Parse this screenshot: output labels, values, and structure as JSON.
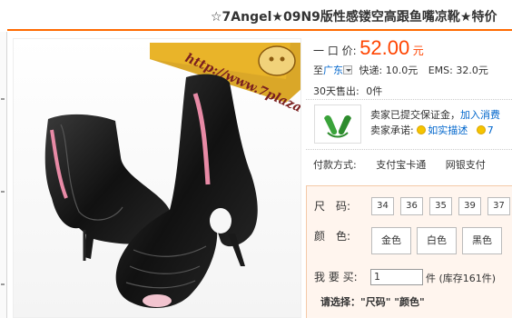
{
  "product": {
    "title": "☆7Angel★09N9版性感镂空高跟鱼嘴凉靴★特价",
    "image_banner": "http://www.7plaza.cn",
    "price_label": "一 口 价:",
    "price": "52.00",
    "currency": "元"
  },
  "shipping": {
    "to_label": "至",
    "area": "广东",
    "express": "快递: 10.0元",
    "ems": "EMS: 32.0元"
  },
  "sales": {
    "sold_label": "30天售出:",
    "sold_value": "0件"
  },
  "guarantee": {
    "line1_text": "卖家已提交保证金，",
    "line1_link": "加入消费",
    "line2_label": "卖家承诺:",
    "line2_link": "如实描述",
    "line2_more": "7"
  },
  "payment": {
    "label": "付款方式:",
    "options": [
      "支付宝卡通",
      "网银支付"
    ]
  },
  "size": {
    "label": "尺　码:",
    "options": [
      "34",
      "36",
      "35",
      "39",
      "37"
    ]
  },
  "color": {
    "label": "颜　色:",
    "options": [
      "金色",
      "白色",
      "黑色"
    ]
  },
  "quantity": {
    "label": "我 要 买:",
    "value": "1",
    "stock_text": "件 (库存161件)"
  },
  "hint": "请选择：\"尺码\" \"颜色\"",
  "colors": {
    "price": "#ff4400",
    "accent": "#ff6a00",
    "link": "#0066cc",
    "panel_bg": "#fff5ee"
  }
}
